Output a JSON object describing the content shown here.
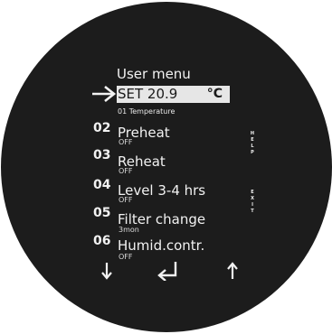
{
  "menu": {
    "title": "User menu",
    "current": {
      "text": "SET 20.9",
      "unit": "°C",
      "description": "01 Temperature"
    },
    "items": [
      {
        "number": "02",
        "label": "Preheat",
        "value": "OFF"
      },
      {
        "number": "03",
        "label": "Reheat",
        "value": "OFF"
      },
      {
        "number": "04",
        "label": "Level 3-4 hrs",
        "value": "OFF"
      },
      {
        "number": "05",
        "label": "Filter change",
        "value": "3mon"
      },
      {
        "number": "06",
        "label": "Humid.contr.",
        "value": "OFF"
      }
    ]
  },
  "side_buttons": {
    "help": [
      "H",
      "E",
      "L",
      "P"
    ],
    "exit": [
      "E",
      "X",
      "I",
      "T"
    ]
  },
  "nav": {
    "down_icon": "arrow-down-icon",
    "enter_icon": "enter-icon",
    "up_icon": "arrow-up-icon"
  },
  "colors": {
    "background": "#1c1c1c",
    "text": "#f2f2f2",
    "highlight": "#e6e6e6"
  }
}
